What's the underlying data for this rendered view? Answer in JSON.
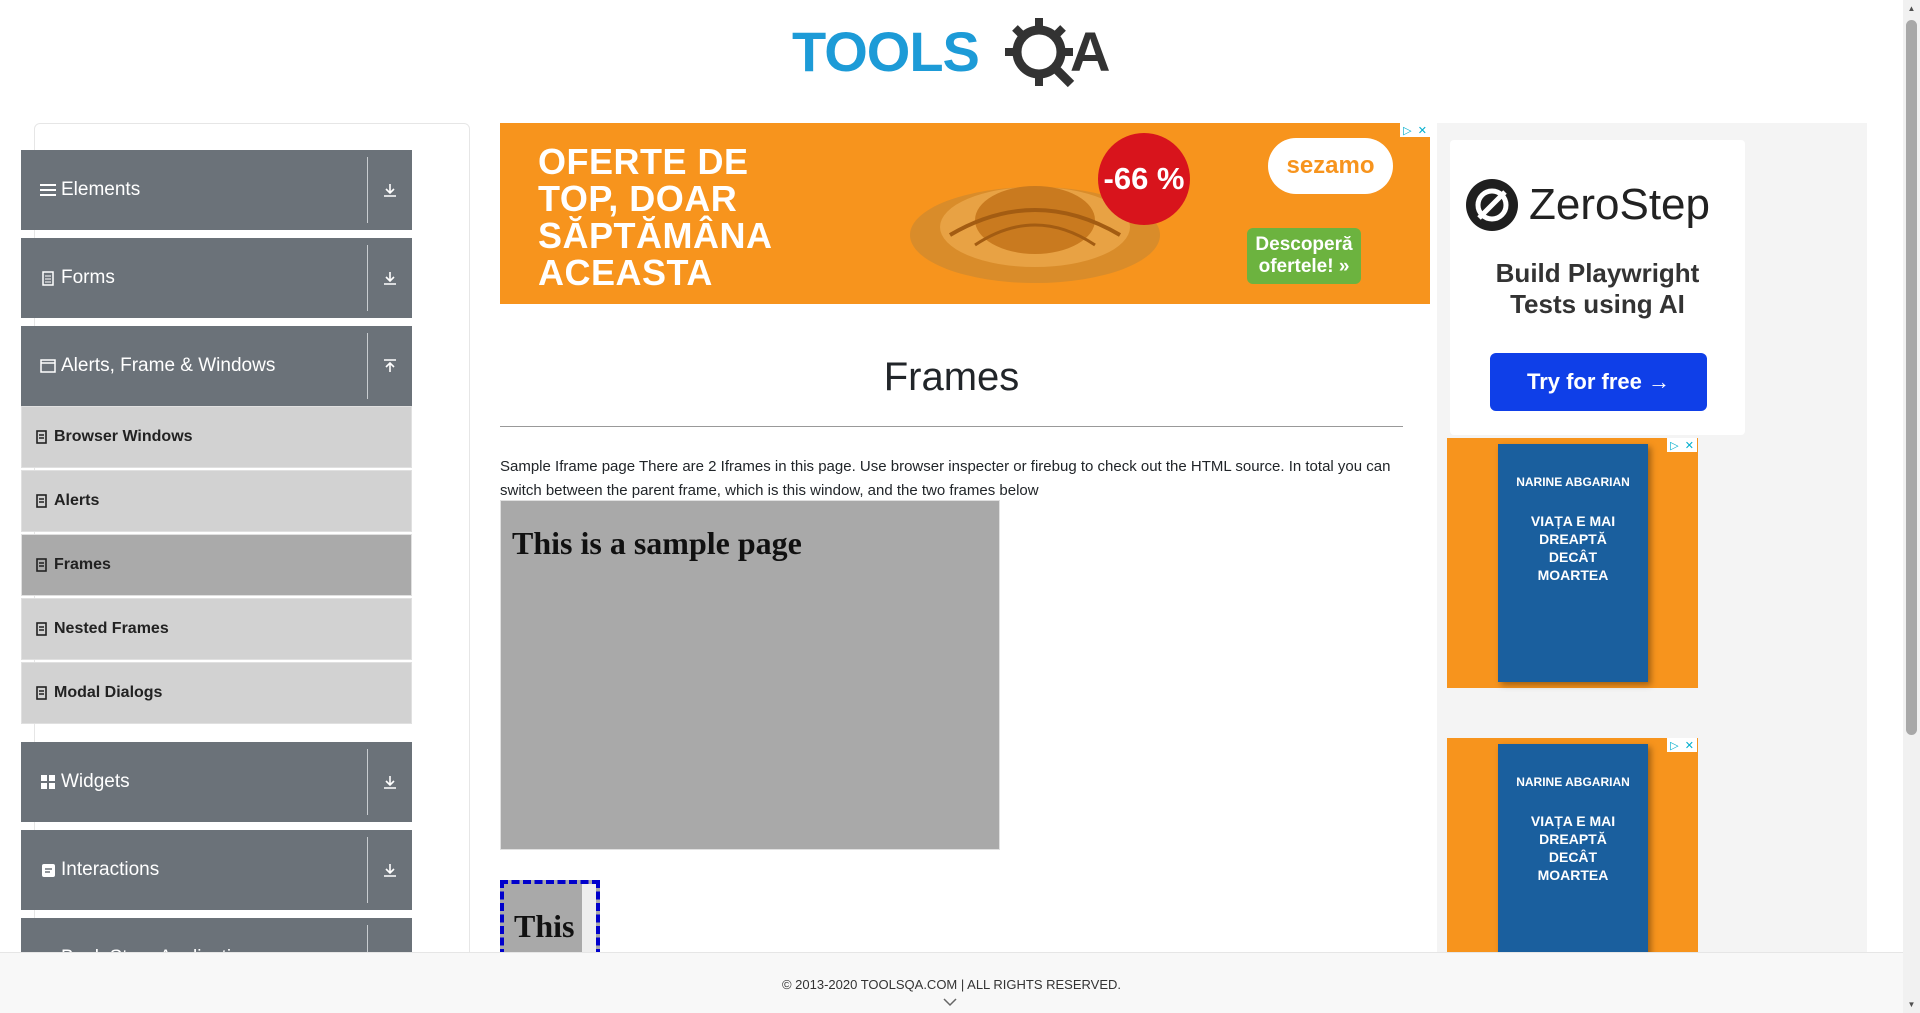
{
  "header": {
    "logo_text": "TOOLSQA"
  },
  "sidebar": {
    "groups": [
      {
        "label": "Elements",
        "icon": "hamburger-icon"
      },
      {
        "label": "Forms",
        "icon": "document-icon"
      },
      {
        "label": "Alerts, Frame & Windows",
        "icon": "window-icon"
      },
      {
        "label": "Widgets",
        "icon": "grid-icon"
      },
      {
        "label": "Interactions",
        "icon": "interactions-icon"
      },
      {
        "label": "Book Store Application",
        "icon": "book-icon"
      }
    ],
    "sub_items": [
      {
        "label": "Browser Windows"
      },
      {
        "label": "Alerts"
      },
      {
        "label": "Frames",
        "active": true
      },
      {
        "label": "Nested Frames"
      },
      {
        "label": "Modal Dialogs"
      }
    ]
  },
  "ads": {
    "top": {
      "promo_text": "OFERTE DE TOP, DOAR SĂPTĂMÂNA ACEASTA",
      "discount": "-66 %",
      "brand": "sezamo",
      "cta": "Descoperă ofertele! »"
    },
    "zerostep": {
      "name": "ZeroStep",
      "tagline": "Build Playwright Tests using AI",
      "cta": "Try for free →"
    },
    "book": {
      "author": "NARINE ABGARIAN",
      "title": "VIAȚA E MAI DREAPTĂ DECÂT MOARTEA"
    }
  },
  "main": {
    "title": "Frames",
    "description": "Sample Iframe page There are 2 Iframes in this page. Use browser inspecter or firebug to check out the HTML source. In total you can switch between the parent frame, which is this window, and the two frames below",
    "frame1_text": "This is a sample page",
    "frame2_text": "This"
  },
  "footer": {
    "text": "© 2013-2020 TOOLSQA.COM | ALL RIGHTS RESERVED."
  },
  "colors": {
    "sidebar_group": "#6b7279",
    "sidebar_sub": "#d2d2d2",
    "sidebar_sub_active": "#aaaaaa",
    "frame_bg": "#a9a9a9",
    "ad_orange": "#f7941d"
  }
}
